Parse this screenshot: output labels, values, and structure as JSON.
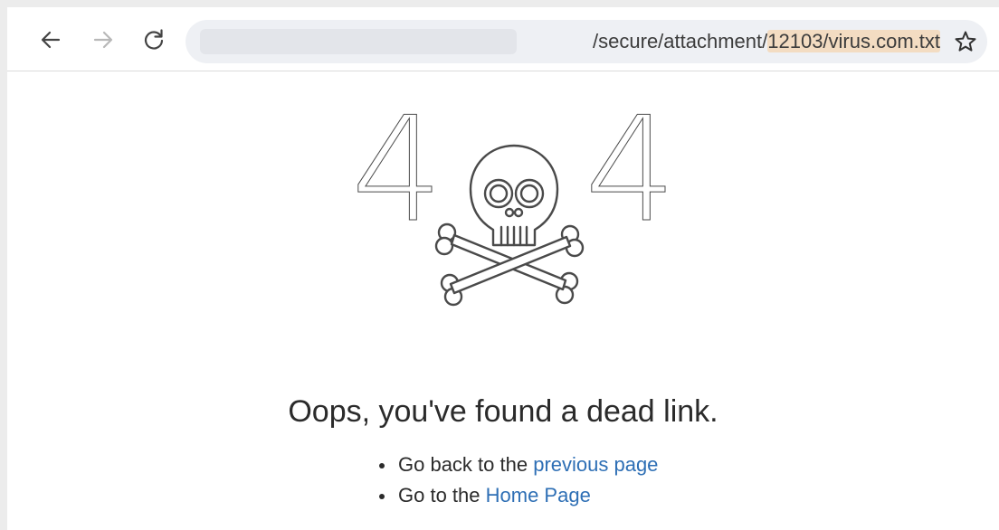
{
  "browser": {
    "url_path": "/secure/attachment/",
    "url_highlight": "12103/virus.com.txt",
    "icons": {
      "back": "back-arrow-icon",
      "forward": "forward-arrow-icon",
      "reload": "reload-icon",
      "bookmark": "star-icon"
    }
  },
  "error_page": {
    "code_left": "4",
    "code_right": "4",
    "illustration": "skull-crossbones-icon",
    "headline": "Oops, you've found a dead link.",
    "items": [
      {
        "prefix": "Go back to the ",
        "link": "previous page"
      },
      {
        "prefix": "Go to the ",
        "link": "Home Page"
      }
    ],
    "colors": {
      "link": "#2e6fb5",
      "text": "#2b2b2b",
      "url_highlight": "#f3dcc2"
    }
  }
}
